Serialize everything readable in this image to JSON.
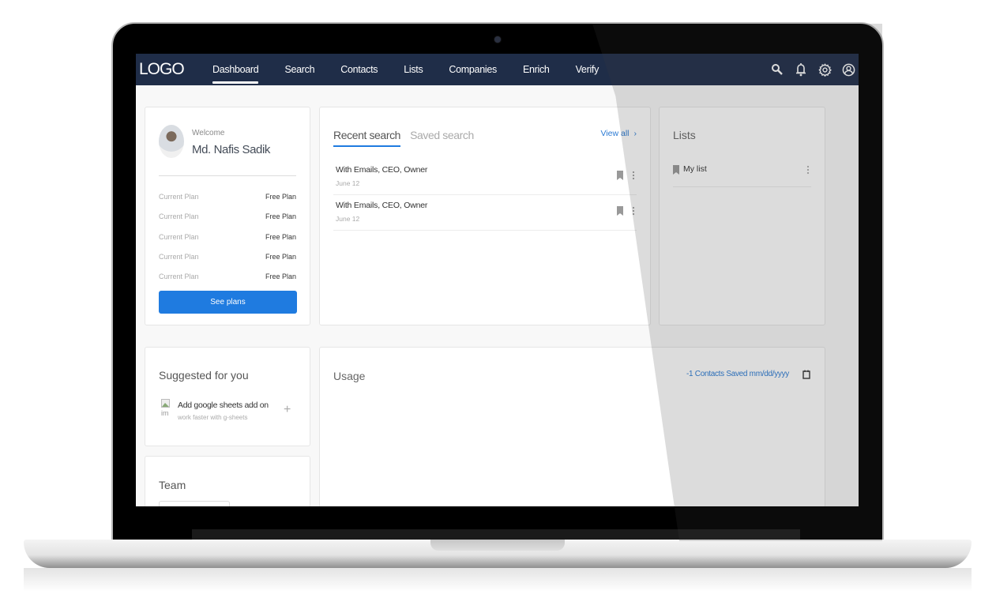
{
  "nav": {
    "logo": "LOGO",
    "items": [
      {
        "label": "Dashboard",
        "active": true
      },
      {
        "label": "Search",
        "active": false
      },
      {
        "label": "Contacts",
        "active": false
      },
      {
        "label": "Lists",
        "active": false
      },
      {
        "label": "Companies",
        "active": false
      },
      {
        "label": "Enrich",
        "active": false
      },
      {
        "label": "Verify",
        "active": false
      }
    ],
    "icons": [
      "search-icon",
      "bell-icon",
      "gear-icon",
      "user-circle-icon"
    ]
  },
  "profile": {
    "welcome": "Welcome",
    "name": "Md. Nafis Sadik",
    "plans": [
      {
        "label": "Current Plan",
        "value": "Free Plan"
      },
      {
        "label": "Current Plan",
        "value": "Free Plan"
      },
      {
        "label": "Current Plan",
        "value": "Free Plan"
      },
      {
        "label": "Current Plan",
        "value": "Free Plan"
      },
      {
        "label": "Current Plan",
        "value": "Free Plan"
      }
    ],
    "button": "See plans"
  },
  "searches": {
    "tabs": [
      {
        "label": "Recent search",
        "active": true
      },
      {
        "label": "Saved search",
        "active": false
      }
    ],
    "view_all": "View all",
    "view_all_icon": "›",
    "rows": [
      {
        "title": "With Emails, CEO, Owner",
        "date": "June 12"
      },
      {
        "title": "With Emails, CEO, Owner",
        "date": "June 12"
      }
    ]
  },
  "lists": {
    "title": "Lists",
    "items": [
      {
        "name": "My list"
      }
    ]
  },
  "suggested": {
    "title": "Suggested for you",
    "image_alt": "im",
    "item_title": "Add google sheets add on",
    "item_desc": "work faster with g-sheets",
    "add": "+"
  },
  "team": {
    "title": "Team"
  },
  "usage": {
    "title": "Usage",
    "meta": "-1 Contacts Saved mm/dd/yyyy"
  },
  "colors": {
    "nav_bg": "#1f2d48",
    "accent": "#1f7be0",
    "link": "#2a7ad4"
  }
}
